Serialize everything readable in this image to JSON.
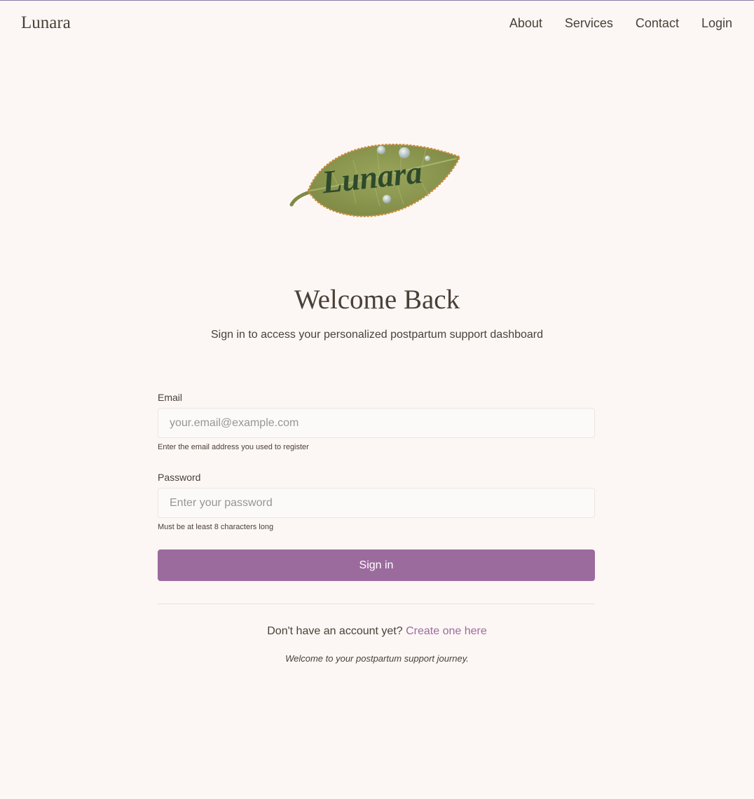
{
  "header": {
    "brand": "Lunara",
    "nav": {
      "about": "About",
      "services": "Services",
      "contact": "Contact",
      "login": "Login"
    }
  },
  "logo": {
    "text": "Lunara",
    "icon": "leaf-logo-icon",
    "colors": {
      "leaf": "#8f9a52",
      "outline": "#c98a3a",
      "script": "#2e4a2c"
    }
  },
  "main": {
    "title": "Welcome Back",
    "subtitle": "Sign in to access your personalized postpartum support dashboard"
  },
  "form": {
    "email": {
      "label": "Email",
      "value": "",
      "placeholder": "your.email@example.com",
      "hint": "Enter the email address you used to register"
    },
    "password": {
      "label": "Password",
      "value": "",
      "placeholder": "Enter your password",
      "hint": "Must be at least 8 characters long"
    },
    "submit_label": "Sign in"
  },
  "footer": {
    "signup_prompt": "Don't have an account yet?",
    "signup_link": "Create one here",
    "note": "Welcome to your postpartum support journey."
  },
  "colors": {
    "background": "#fcf7f4",
    "accent": "#9c6b9e",
    "text": "#4a4039"
  }
}
